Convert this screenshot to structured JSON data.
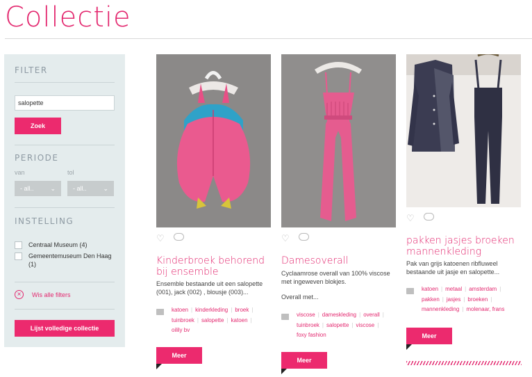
{
  "page": {
    "title": "Collectie"
  },
  "sidebar": {
    "filter_heading": "FILTER",
    "search": {
      "value": "salopette",
      "placeholder": ""
    },
    "search_button": "Zoek",
    "period_heading": "PERIODE",
    "from_label": "van",
    "to_label": "tol",
    "from_select": "- all..",
    "to_select": "- all..",
    "institution_heading": "INSTELLING",
    "institutions": [
      {
        "label": "Centraal Museum (4)"
      },
      {
        "label": "Gemeentemuseum Den Haag (1)"
      }
    ],
    "clear_filters": "Wis alle filters",
    "full_collection_button": "Lijst volledige collectie"
  },
  "cards": [
    {
      "title": "Kinderbroek behorend bij ensemble",
      "description": "Ensemble bestaande uit een salopette (001), jack (002) , blousje (003)...",
      "tags": [
        "katoen",
        "kinderkleding",
        "broek",
        "tuinbroek",
        "salopette",
        "katoen",
        "oilily bv"
      ],
      "more": "Meer"
    },
    {
      "title": "Damesoverall",
      "description": "Cyclaamrose overall van 100% viscose met ingeweven blokjes.",
      "description2": "Overall met...",
      "tags": [
        "viscose",
        "dameskleding",
        "overall",
        "tuinbroek",
        "salopette",
        "viscose",
        "foxy fashion"
      ],
      "more": "Meer"
    },
    {
      "title": "pakken jasjes broeken mannenkleding",
      "description": "Pak van grijs katoenen ribfluweel bestaande uit jasje en salopette...",
      "tags": [
        "katoen",
        "metaal",
        "amsterdam",
        "pakken",
        "jasjes",
        "broeken",
        "mannenkleding",
        "molenaar, frans"
      ],
      "more": "Meer"
    }
  ],
  "colors": {
    "accent": "#ec2a6e",
    "sidebar_bg": "#e4eced"
  }
}
